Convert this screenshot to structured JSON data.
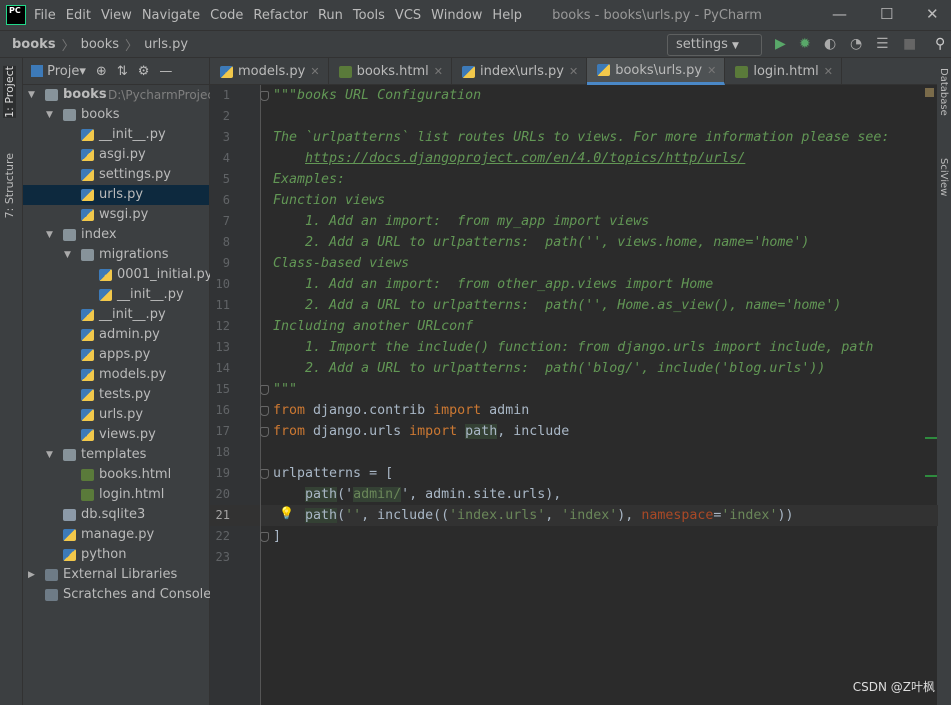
{
  "titlebar": {
    "logo": "PC",
    "menu": [
      "File",
      "Edit",
      "View",
      "Navigate",
      "Code",
      "Refactor",
      "Run",
      "Tools",
      "VCS",
      "Window",
      "Help"
    ],
    "title": "books - books\\urls.py - PyCharm"
  },
  "breadcrumb": [
    "books",
    "books",
    "urls.py"
  ],
  "run_config": "settings",
  "side_tabs": {
    "left": [
      "1: Project",
      "7: Structure"
    ],
    "right": [
      "Database",
      "SciView"
    ]
  },
  "project": {
    "title": "Proje",
    "tree": [
      {
        "name": "books",
        "hint": "D:\\PycharmProject",
        "type": "folder",
        "depth": 0,
        "open": true,
        "bold": true
      },
      {
        "name": "books",
        "type": "folder",
        "depth": 1,
        "open": true
      },
      {
        "name": "__init__.py",
        "type": "py",
        "depth": 2
      },
      {
        "name": "asgi.py",
        "type": "py",
        "depth": 2
      },
      {
        "name": "settings.py",
        "type": "py",
        "depth": 2
      },
      {
        "name": "urls.py",
        "type": "py",
        "depth": 2,
        "selected": true
      },
      {
        "name": "wsgi.py",
        "type": "py",
        "depth": 2
      },
      {
        "name": "index",
        "type": "folder",
        "depth": 1,
        "open": true
      },
      {
        "name": "migrations",
        "type": "folder",
        "depth": 2,
        "open": true
      },
      {
        "name": "0001_initial.py",
        "type": "py",
        "depth": 3
      },
      {
        "name": "__init__.py",
        "type": "py",
        "depth": 3
      },
      {
        "name": "__init__.py",
        "type": "py",
        "depth": 2
      },
      {
        "name": "admin.py",
        "type": "py",
        "depth": 2
      },
      {
        "name": "apps.py",
        "type": "py",
        "depth": 2
      },
      {
        "name": "models.py",
        "type": "py",
        "depth": 2
      },
      {
        "name": "tests.py",
        "type": "py",
        "depth": 2
      },
      {
        "name": "urls.py",
        "type": "py",
        "depth": 2
      },
      {
        "name": "views.py",
        "type": "py",
        "depth": 2
      },
      {
        "name": "templates",
        "type": "folder",
        "depth": 1,
        "open": true
      },
      {
        "name": "books.html",
        "type": "html",
        "depth": 2
      },
      {
        "name": "login.html",
        "type": "html",
        "depth": 2
      },
      {
        "name": "db.sqlite3",
        "type": "db",
        "depth": 1
      },
      {
        "name": "manage.py",
        "type": "py",
        "depth": 1
      },
      {
        "name": "python",
        "type": "py",
        "depth": 1
      },
      {
        "name": "External Libraries",
        "type": "lib",
        "depth": 0,
        "open": false
      },
      {
        "name": "Scratches and Consoles",
        "type": "lib",
        "depth": 0
      }
    ]
  },
  "tabs": [
    {
      "label": "models.py",
      "type": "py"
    },
    {
      "label": "books.html",
      "type": "html"
    },
    {
      "label": "index\\urls.py",
      "type": "py"
    },
    {
      "label": "books\\urls.py",
      "type": "py",
      "active": true
    },
    {
      "label": "login.html",
      "type": "html"
    }
  ],
  "editor": {
    "current_line": 21,
    "lines": [
      [
        [
          "\"\"\"books URL Configuration",
          "doc"
        ]
      ],
      [],
      [
        [
          "The `urlpatterns` list routes URLs to views. For more information please see:",
          "doc"
        ]
      ],
      [
        [
          "    ",
          "doc"
        ],
        [
          "https://docs.djangoproject.com/en/4.0/topics/http/urls/",
          "link"
        ]
      ],
      [
        [
          "Examples:",
          "doc"
        ]
      ],
      [
        [
          "Function views",
          "doc"
        ]
      ],
      [
        [
          "    1. Add an import:  from my_app import views",
          "doc"
        ]
      ],
      [
        [
          "    2. Add a URL to urlpatterns:  path('', views.home, name='home')",
          "doc"
        ]
      ],
      [
        [
          "Class-based views",
          "doc"
        ]
      ],
      [
        [
          "    1. Add an import:  from other_app.views import Home",
          "doc"
        ]
      ],
      [
        [
          "    2. Add a URL to urlpatterns:  path('', Home.as_view(), name='home')",
          "doc"
        ]
      ],
      [
        [
          "Including another URLconf",
          "doc"
        ]
      ],
      [
        [
          "    1. Import the include() function: from django.urls import include, path",
          "doc"
        ]
      ],
      [
        [
          "    2. Add a URL to urlpatterns:  path('blog/', include('blog.urls'))",
          "doc"
        ]
      ],
      [
        [
          "\"\"\"",
          "doc"
        ]
      ],
      [
        [
          "from",
          "kw"
        ],
        [
          " django.contrib ",
          ""
        ],
        [
          "import",
          "kw"
        ],
        [
          " admin",
          ""
        ]
      ],
      [
        [
          "from",
          "kw"
        ],
        [
          " django.urls ",
          ""
        ],
        [
          "import",
          "kw"
        ],
        [
          " ",
          ""
        ],
        [
          "path",
          "hl"
        ],
        [
          ", include",
          ""
        ]
      ],
      [],
      [
        [
          "urlpatterns = [",
          ""
        ]
      ],
      [
        [
          "    ",
          ""
        ],
        [
          "path",
          "hl"
        ],
        [
          "(",
          ""
        ],
        [
          "'",
          ""
        ],
        [
          "admin/",
          "str hl"
        ],
        [
          "'",
          ""
        ],
        [
          ", admin.site.urls),",
          ""
        ]
      ],
      [
        [
          "    ",
          ""
        ],
        [
          "path",
          "hl"
        ],
        [
          "(",
          ""
        ],
        [
          "''",
          "str"
        ],
        [
          ", include((",
          ""
        ],
        [
          "'index.urls'",
          "str"
        ],
        [
          ", ",
          ""
        ],
        [
          "'index'",
          "str"
        ],
        [
          "), ",
          ""
        ],
        [
          "namespace",
          "kwarg"
        ],
        [
          "=",
          ""
        ],
        [
          "'index'",
          "str"
        ],
        [
          "))",
          ""
        ]
      ],
      [
        [
          "]",
          ""
        ]
      ],
      []
    ]
  },
  "watermark": "CSDN @Z叶枫"
}
